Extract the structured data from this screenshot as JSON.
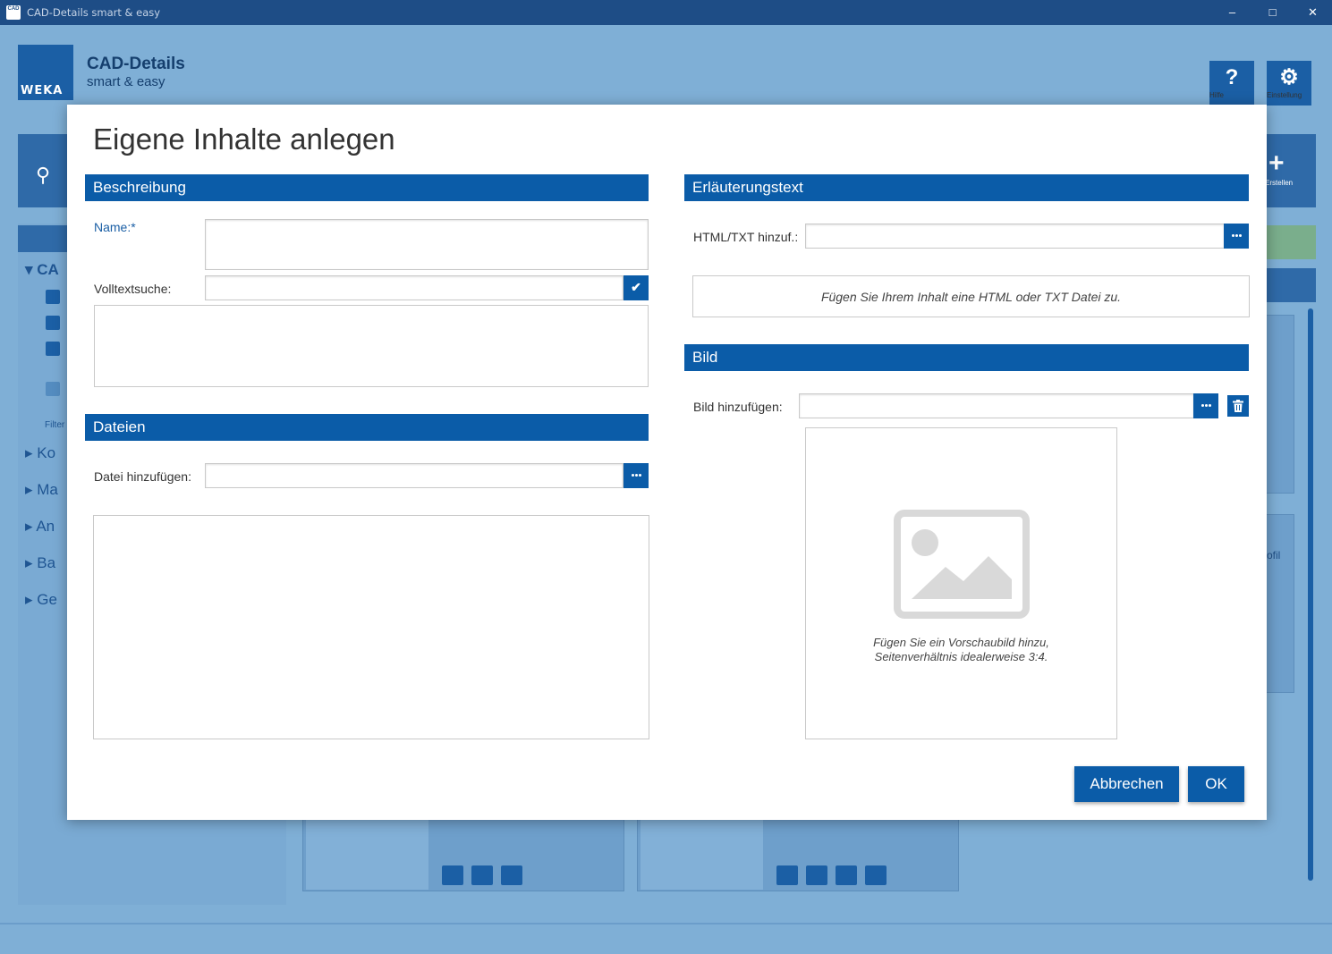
{
  "window": {
    "title": "CAD-Details smart & easy",
    "app_icon_text": "CAD"
  },
  "brand": {
    "logo_text": "WEKA",
    "title": "CAD-Details",
    "subtitle": "smart & easy"
  },
  "header_buttons": {
    "help_label": "Hilfe",
    "settings_label": "Einstellung",
    "create_label": "Erstellen"
  },
  "background": {
    "side_items": [
      "CA",
      "Ko",
      "Ma",
      "An",
      "Ba",
      "Ge"
    ],
    "filter_label": "Filter",
    "card_text": "ofil"
  },
  "dialog": {
    "title": "Eigene Inhalte anlegen",
    "beschreibung": {
      "header": "Beschreibung",
      "name_label": "Name:*",
      "volltext_label": "Volltextsuche:",
      "name_value": "",
      "volltext_value": ""
    },
    "dateien": {
      "header": "Dateien",
      "datei_label": "Datei hinzufügen:",
      "datei_value": ""
    },
    "erlaeuterung": {
      "header": "Erläuterungstext",
      "html_label": "HTML/TXT hinzuf.:",
      "html_value": "",
      "hint": "Fügen Sie Ihrem Inhalt eine HTML oder TXT Datei zu."
    },
    "bild": {
      "header": "Bild",
      "bild_label": "Bild hinzufügen:",
      "bild_value": "",
      "preview_hint_line1": "Fügen Sie ein Vorschaubild hinzu,",
      "preview_hint_line2": "Seitenverhältnis idealerweise 3:4."
    },
    "buttons": {
      "cancel": "Abbrechen",
      "ok": "OK"
    }
  },
  "colors": {
    "accent": "#0b5ca8",
    "titlebar": "#1e4d86",
    "overlay": "#7fafd6"
  }
}
